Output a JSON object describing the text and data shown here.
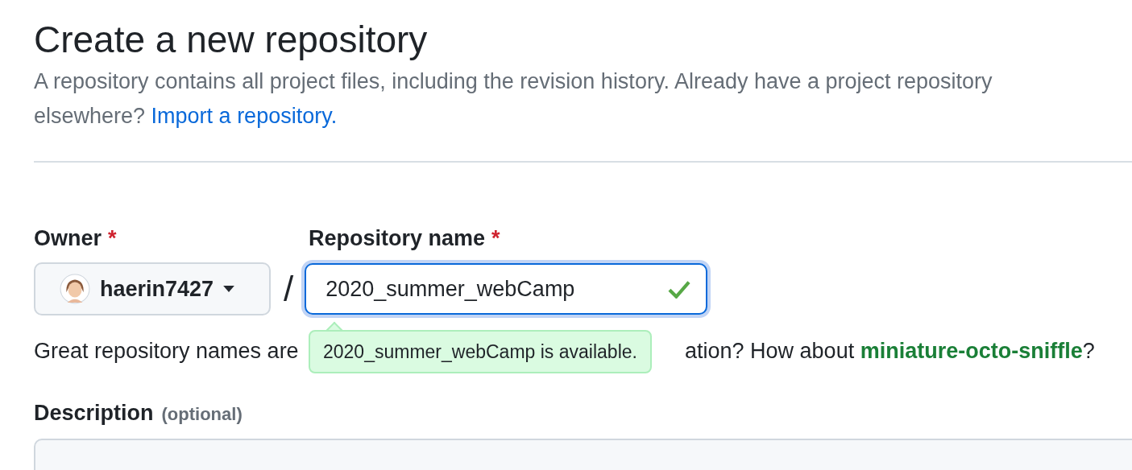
{
  "title": "Create a new repository",
  "intro": {
    "text": "A repository contains all project files, including the revision history. Already have a project repository elsewhere?",
    "link": "Import a repository."
  },
  "owner": {
    "label": "Owner",
    "required_mark": "*",
    "value": "haerin7427"
  },
  "separator": "/",
  "repo_name": {
    "label": "Repository name",
    "required_mark": "*",
    "value": "2020_summer_webCamp",
    "valid": true,
    "focused": true
  },
  "tooltip": "2020_summer_webCamp is available.",
  "hint": {
    "before": "Great repository names are",
    "after": "ation? How about",
    "suggestion": "miniature-octo-sniffle",
    "end": "?"
  },
  "description": {
    "label": "Description",
    "optional": "(optional)"
  }
}
